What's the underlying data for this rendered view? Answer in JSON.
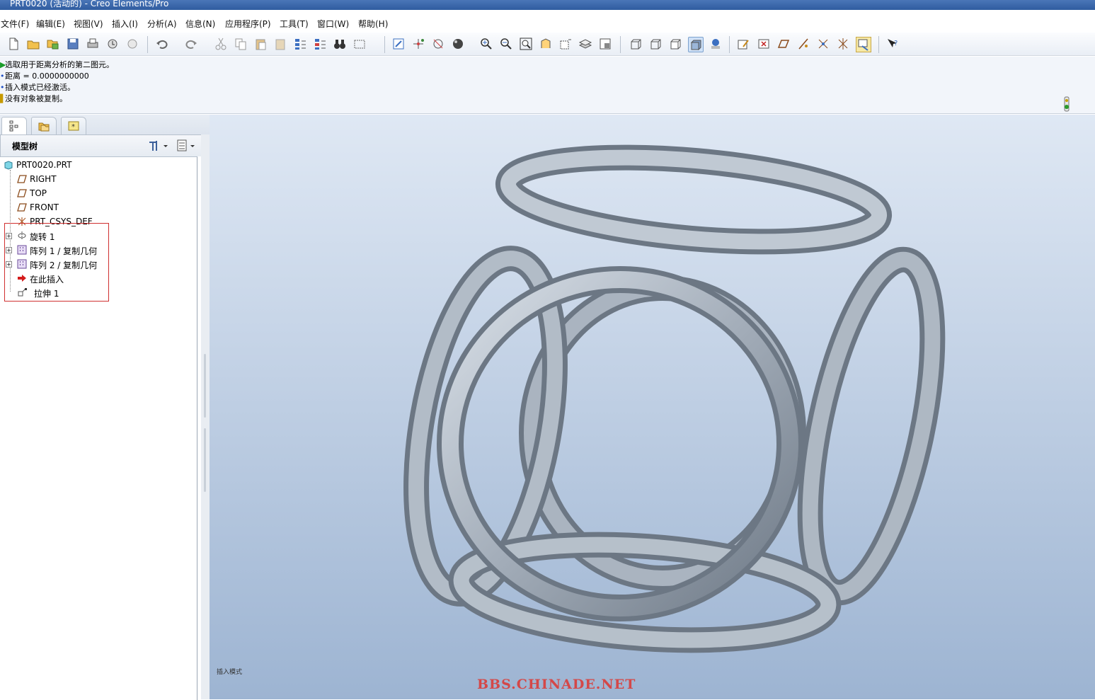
{
  "window": {
    "title": "PRT0020 (活动的) - Creo Elements/Pro"
  },
  "menu": [
    {
      "label": "文件(F)"
    },
    {
      "label": "编辑(E)"
    },
    {
      "label": "视图(V)"
    },
    {
      "label": "插入(I)"
    },
    {
      "label": "分析(A)"
    },
    {
      "label": "信息(N)"
    },
    {
      "label": "应用程序(P)"
    },
    {
      "label": "工具(T)"
    },
    {
      "label": "窗口(W)"
    },
    {
      "label": "帮助(H)"
    }
  ],
  "messages": [
    {
      "text": "选取用于距离分析的第二图元。",
      "color": "#1a9c2a"
    },
    {
      "text": "距离 = 0.0000000000",
      "color": "#1f4fc4"
    },
    {
      "text": "插入模式已经激活。",
      "color": "#1f4fc4"
    },
    {
      "text": "没有对象被复制。",
      "color": "#c79a00"
    }
  ],
  "tree": {
    "header": "模型树",
    "root": "PRT0020.PRT",
    "items": [
      {
        "label": "RIGHT",
        "icon": "datum-plane-icon",
        "expandable": false
      },
      {
        "label": "TOP",
        "icon": "datum-plane-icon",
        "expandable": false
      },
      {
        "label": "FRONT",
        "icon": "datum-plane-icon",
        "expandable": false
      },
      {
        "label": "PRT_CSYS_DEF",
        "icon": "csys-icon",
        "expandable": false
      },
      {
        "label": "旋转 1",
        "icon": "revolve-icon",
        "expandable": true
      },
      {
        "label": "阵列 1 / 复制几何",
        "icon": "pattern-icon",
        "expandable": true
      },
      {
        "label": "阵列 2 / 复制几何",
        "icon": "pattern-icon",
        "expandable": true
      },
      {
        "label": "在此插入",
        "icon": "insert-here-arrow-icon",
        "expandable": false
      },
      {
        "label": "拉伸 1",
        "icon": "extrude-icon",
        "expandable": false
      }
    ]
  },
  "viewport": {
    "mode_hint": "插入模式",
    "watermark": "BBS.CHINADE.NET"
  },
  "colors": {
    "accent_red": "#d03030",
    "model_gray": "#9aa5b1"
  }
}
